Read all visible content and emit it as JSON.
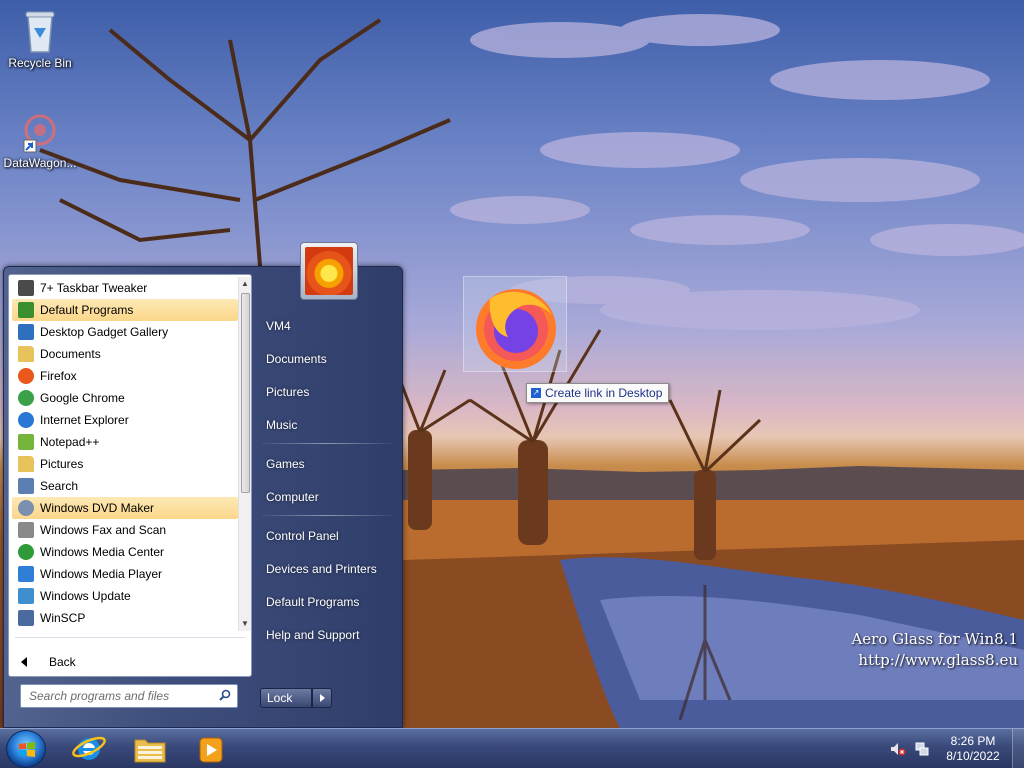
{
  "desktop": {
    "icons": [
      {
        "label": "Recycle Bin",
        "icon": "recycle-bin-icon"
      },
      {
        "label": "DataWagon...",
        "icon": "datawagon-shortcut-icon"
      }
    ],
    "watermark": {
      "line1": "Aero Glass for Win8.1",
      "line2": "http://www.glass8.eu"
    },
    "drag": {
      "tooltip": "Create link in Desktop",
      "icon": "firefox-icon"
    }
  },
  "start_menu": {
    "programs": [
      {
        "label": "7+ Taskbar Tweaker",
        "icon": "taskbar-tweaker-icon",
        "color": "#4a4a4a",
        "highlighted": false
      },
      {
        "label": "Default Programs",
        "icon": "default-programs-icon",
        "color": "#3b8f2e",
        "highlighted": true
      },
      {
        "label": "Desktop Gadget Gallery",
        "icon": "gadget-gallery-icon",
        "color": "#2f6fc0",
        "highlighted": false
      },
      {
        "label": "Documents",
        "icon": "folder-icon",
        "color": "#e8c25a",
        "highlighted": false
      },
      {
        "label": "Firefox",
        "icon": "firefox-icon",
        "color": "#e8591a",
        "highlighted": false
      },
      {
        "label": "Google Chrome",
        "icon": "chrome-icon",
        "color": "#3aa04a",
        "highlighted": false
      },
      {
        "label": "Internet Explorer",
        "icon": "ie-icon",
        "color": "#2a78d6",
        "highlighted": false
      },
      {
        "label": "Notepad++",
        "icon": "notepadpp-icon",
        "color": "#74b53a",
        "highlighted": false
      },
      {
        "label": "Pictures",
        "icon": "folder-icon",
        "color": "#e8c25a",
        "highlighted": false
      },
      {
        "label": "Search",
        "icon": "search-icon",
        "color": "#5b7fb0",
        "highlighted": false
      },
      {
        "label": "Windows DVD Maker",
        "icon": "dvd-maker-icon",
        "color": "#7a8fb0",
        "highlighted": true
      },
      {
        "label": "Windows Fax and Scan",
        "icon": "fax-scan-icon",
        "color": "#8a8a8a",
        "highlighted": false
      },
      {
        "label": "Windows Media Center",
        "icon": "media-center-icon",
        "color": "#2e9a3a",
        "highlighted": false
      },
      {
        "label": "Windows Media Player",
        "icon": "media-player-icon",
        "color": "#2f7fd6",
        "highlighted": false
      },
      {
        "label": "Windows Update",
        "icon": "windows-update-icon",
        "color": "#3d8fd0",
        "highlighted": false
      },
      {
        "label": "WinSCP",
        "icon": "winscp-icon",
        "color": "#4a6aa0",
        "highlighted": false
      }
    ],
    "back_label": "Back",
    "search_placeholder": "Search programs and files",
    "right_links": {
      "user": "VM4",
      "documents": "Documents",
      "pictures": "Pictures",
      "music": "Music",
      "games": "Games",
      "computer": "Computer",
      "control_panel": "Control Panel",
      "devices": "Devices and Printers",
      "default_programs": "Default Programs",
      "help": "Help and Support"
    },
    "lock_label": "Lock"
  },
  "taskbar": {
    "pinned": [
      {
        "name": "Internet Explorer",
        "icon": "ie-icon"
      },
      {
        "name": "Windows Explorer",
        "icon": "explorer-folder-icon"
      },
      {
        "name": "Windows Media Player",
        "icon": "media-player-icon"
      }
    ],
    "clock": {
      "time": "8:26 PM",
      "date": "8/10/2022"
    },
    "tray_icons": [
      "volume-muted-icon",
      "network-icon"
    ]
  }
}
